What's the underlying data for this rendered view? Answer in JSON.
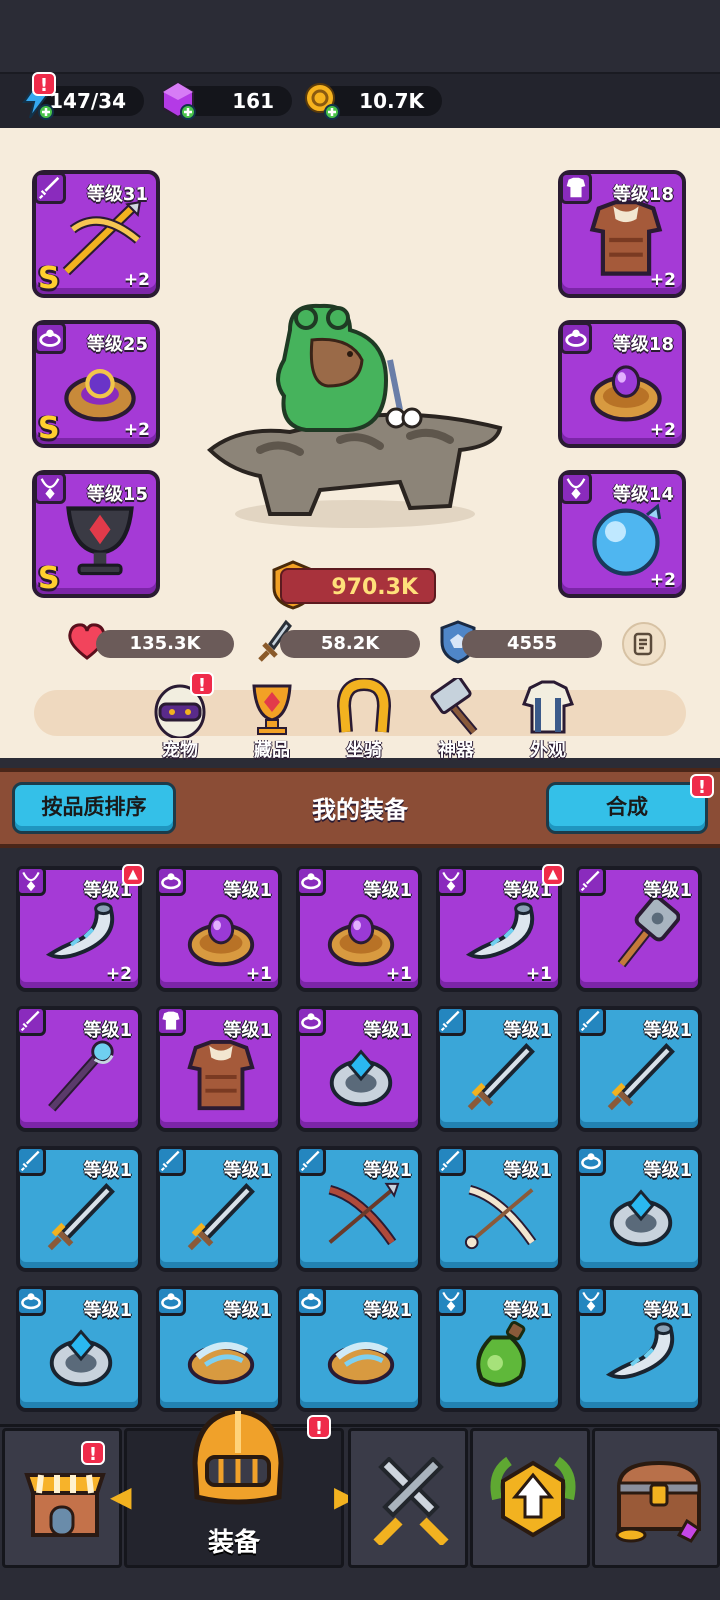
{
  "resources": {
    "energy": "147/34",
    "gems": "161",
    "coins": "10.7K"
  },
  "hero": {
    "left_slots": [
      {
        "level": "等级31",
        "plus": "+2",
        "grade": "S",
        "slot_icon": "sword-icon",
        "item": "crossbow-icon"
      },
      {
        "level": "等级25",
        "plus": "+2",
        "grade": "S",
        "slot_icon": "ring-icon",
        "item": "ornate-ring-icon"
      },
      {
        "level": "等级15",
        "plus": "",
        "grade": "S",
        "slot_icon": "necklace-icon",
        "item": "chalice-icon"
      }
    ],
    "right_slots": [
      {
        "level": "等级18",
        "plus": "+2",
        "grade": "",
        "slot_icon": "armor-icon",
        "item": "fur-armor-icon"
      },
      {
        "level": "等级18",
        "plus": "+2",
        "grade": "",
        "slot_icon": "ring-icon",
        "item": "gem-ring-icon"
      },
      {
        "level": "等级14",
        "plus": "+2",
        "grade": "",
        "slot_icon": "necklace-icon",
        "item": "orb-icon"
      }
    ],
    "power": "970.3K",
    "hp": "135.3K",
    "attack": "58.2K",
    "defense": "4555"
  },
  "menu": [
    {
      "label": "宠物",
      "icon": "pet-egg-icon",
      "alert": true
    },
    {
      "label": "藏品",
      "icon": "trophy-icon",
      "alert": false
    },
    {
      "label": "坐骑",
      "icon": "horseshoe-icon",
      "alert": false
    },
    {
      "label": "神器",
      "icon": "hammer-icon",
      "alert": false
    },
    {
      "label": "外观",
      "icon": "outfit-icon",
      "alert": false
    }
  ],
  "equipment": {
    "title": "我的装备",
    "sort_button": "按品质排序",
    "merge_button": "合成",
    "items": [
      {
        "level": "等级1",
        "plus": "+2",
        "color": "purple",
        "slot_icon": "necklace-icon",
        "item": "horn-icon",
        "up": true
      },
      {
        "level": "等级1",
        "plus": "+1",
        "color": "purple",
        "slot_icon": "ring-icon",
        "item": "gem-ring-icon",
        "up": false
      },
      {
        "level": "等级1",
        "plus": "+1",
        "color": "purple",
        "slot_icon": "ring-icon",
        "item": "gem-ring-icon",
        "up": false
      },
      {
        "level": "等级1",
        "plus": "+1",
        "color": "purple",
        "slot_icon": "necklace-icon",
        "item": "horn-icon",
        "up": true
      },
      {
        "level": "等级1",
        "plus": "",
        "color": "purple",
        "slot_icon": "sword-icon",
        "item": "war-hammer-icon",
        "up": false
      },
      {
        "level": "等级1",
        "plus": "",
        "color": "purple",
        "slot_icon": "sword-icon",
        "item": "staff-icon",
        "up": false
      },
      {
        "level": "等级1",
        "plus": "",
        "color": "purple",
        "slot_icon": "armor-icon",
        "item": "fur-armor-icon",
        "up": false
      },
      {
        "level": "等级1",
        "plus": "",
        "color": "purple",
        "slot_icon": "ring-icon",
        "item": "crystal-ring-icon",
        "up": false
      },
      {
        "level": "等级1",
        "plus": "",
        "color": "blue",
        "slot_icon": "sword-icon",
        "item": "sword-icon",
        "up": false
      },
      {
        "level": "等级1",
        "plus": "",
        "color": "blue",
        "slot_icon": "sword-icon",
        "item": "sword-icon",
        "up": false
      },
      {
        "level": "等级1",
        "plus": "",
        "color": "blue",
        "slot_icon": "sword-icon",
        "item": "sword-icon",
        "up": false
      },
      {
        "level": "等级1",
        "plus": "",
        "color": "blue",
        "slot_icon": "sword-icon",
        "item": "sword-icon",
        "up": false
      },
      {
        "level": "等级1",
        "plus": "",
        "color": "blue",
        "slot_icon": "sword-icon",
        "item": "bow-icon",
        "up": false
      },
      {
        "level": "等级1",
        "plus": "",
        "color": "blue",
        "slot_icon": "sword-icon",
        "item": "bone-bow-icon",
        "up": false
      },
      {
        "level": "等级1",
        "plus": "",
        "color": "blue",
        "slot_icon": "ring-icon",
        "item": "crystal-ring-icon",
        "up": false
      },
      {
        "level": "等级1",
        "plus": "",
        "color": "blue",
        "slot_icon": "ring-icon",
        "item": "crystal-ring-icon",
        "up": false
      },
      {
        "level": "等级1",
        "plus": "",
        "color": "blue",
        "slot_icon": "ring-icon",
        "item": "wind-ring-icon",
        "up": false
      },
      {
        "level": "等级1",
        "plus": "",
        "color": "blue",
        "slot_icon": "ring-icon",
        "item": "wind-ring-icon",
        "up": false
      },
      {
        "level": "等级1",
        "plus": "",
        "color": "blue",
        "slot_icon": "necklace-icon",
        "item": "potion-icon",
        "up": false
      },
      {
        "level": "等级1",
        "plus": "",
        "color": "blue",
        "slot_icon": "necklace-icon",
        "item": "horn-icon",
        "up": false
      }
    ]
  },
  "nav": {
    "active_label": "装备",
    "tabs": [
      "shop-icon",
      "helmet-icon",
      "crossed-swords-icon",
      "upgrade-icon",
      "treasure-chest-icon"
    ]
  }
}
